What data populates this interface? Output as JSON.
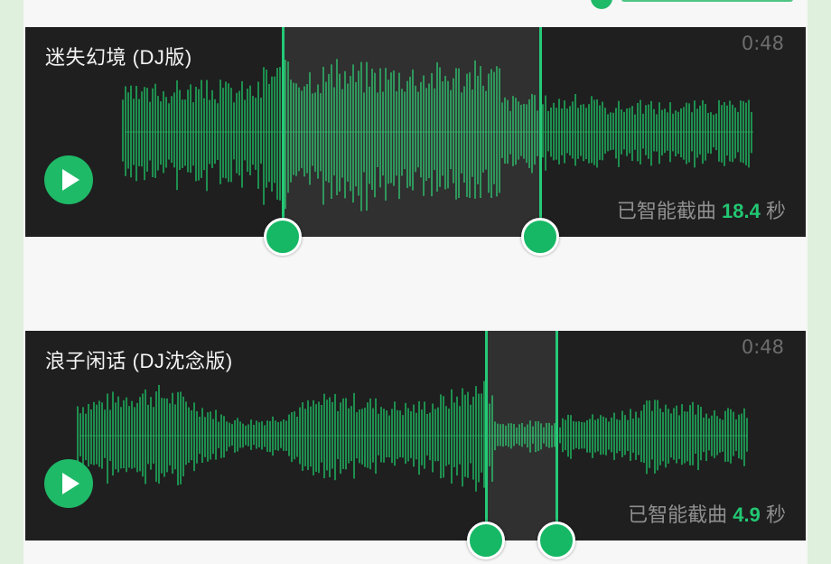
{
  "header": {
    "badge_color": "#1fba68"
  },
  "tracks": [
    {
      "title": "迷失幻境 (DJ版)",
      "duration": "0:48",
      "clip_prefix": "已智能截曲",
      "clip_seconds": "18.4",
      "clip_suffix": "秒",
      "selection_start_fraction": 0.33,
      "selection_end_fraction": 0.66
    },
    {
      "title": "浪子闲话 (DJ沈念版)",
      "duration": "0:48",
      "clip_prefix": "已智能截曲",
      "clip_seconds": "4.9",
      "clip_suffix": "秒",
      "selection_start_fraction": 0.59,
      "selection_end_fraction": 0.68
    }
  ],
  "colors": {
    "accent": "#1fba68",
    "card_background": "#1f1f1f",
    "wave": "#1e8f4f",
    "clip_number": "#22c772"
  },
  "icons": {
    "play": "play-icon"
  }
}
